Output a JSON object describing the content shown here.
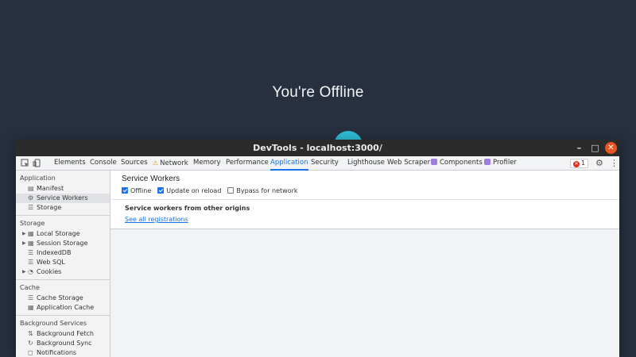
{
  "background": {
    "heading": "You're Offline",
    "accent": "#2fbfd8"
  },
  "window": {
    "title": "DevTools - localhost:3000/",
    "controls": {
      "minimize": "–",
      "maximize": "□",
      "close": "✕"
    }
  },
  "toolbar": {
    "inspect_icon": "⬚",
    "device_icon": "▯",
    "tabs": [
      {
        "label": "Elements"
      },
      {
        "label": "Console"
      },
      {
        "label": "Sources"
      },
      {
        "label": "Network",
        "icon": "⚠"
      },
      {
        "label": "Memory"
      },
      {
        "label": "Performance"
      },
      {
        "label": "Application",
        "active": true
      },
      {
        "label": "Security"
      },
      {
        "label": "Lighthouse"
      },
      {
        "label": "Web Scraper"
      },
      {
        "label": "Components"
      },
      {
        "label": "Profiler"
      }
    ],
    "error_count": "1",
    "error_icon": "✕",
    "settings_icon": "⚙",
    "more_icon": "⋮"
  },
  "sidebar": {
    "sections": [
      {
        "header": "Application",
        "items": [
          {
            "label": "Manifest",
            "icon": "▤"
          },
          {
            "label": "Service Workers",
            "icon": "⚙",
            "selected": true
          },
          {
            "label": "Storage",
            "icon": "☰"
          }
        ]
      },
      {
        "header": "Storage",
        "items": [
          {
            "label": "Local Storage",
            "icon": "▦",
            "expandable": true
          },
          {
            "label": "Session Storage",
            "icon": "▦",
            "expandable": true
          },
          {
            "label": "IndexedDB",
            "icon": "☰"
          },
          {
            "label": "Web SQL",
            "icon": "☰"
          },
          {
            "label": "Cookies",
            "icon": "◔",
            "expandable": true
          }
        ]
      },
      {
        "header": "Cache",
        "items": [
          {
            "label": "Cache Storage",
            "icon": "☰"
          },
          {
            "label": "Application Cache",
            "icon": "▦"
          }
        ]
      },
      {
        "header": "Background Services",
        "items": [
          {
            "label": "Background Fetch",
            "icon": "⇅"
          },
          {
            "label": "Background Sync",
            "icon": "↻"
          },
          {
            "label": "Notifications",
            "icon": "◻"
          }
        ]
      }
    ]
  },
  "main": {
    "title": "Service Workers",
    "options": [
      {
        "label": "Offline",
        "checked": true
      },
      {
        "label": "Update on reload",
        "checked": true
      },
      {
        "label": "Bypass for network",
        "checked": false
      }
    ],
    "other_origins_heading": "Service workers from other origins",
    "see_all_link": "See all registrations"
  }
}
